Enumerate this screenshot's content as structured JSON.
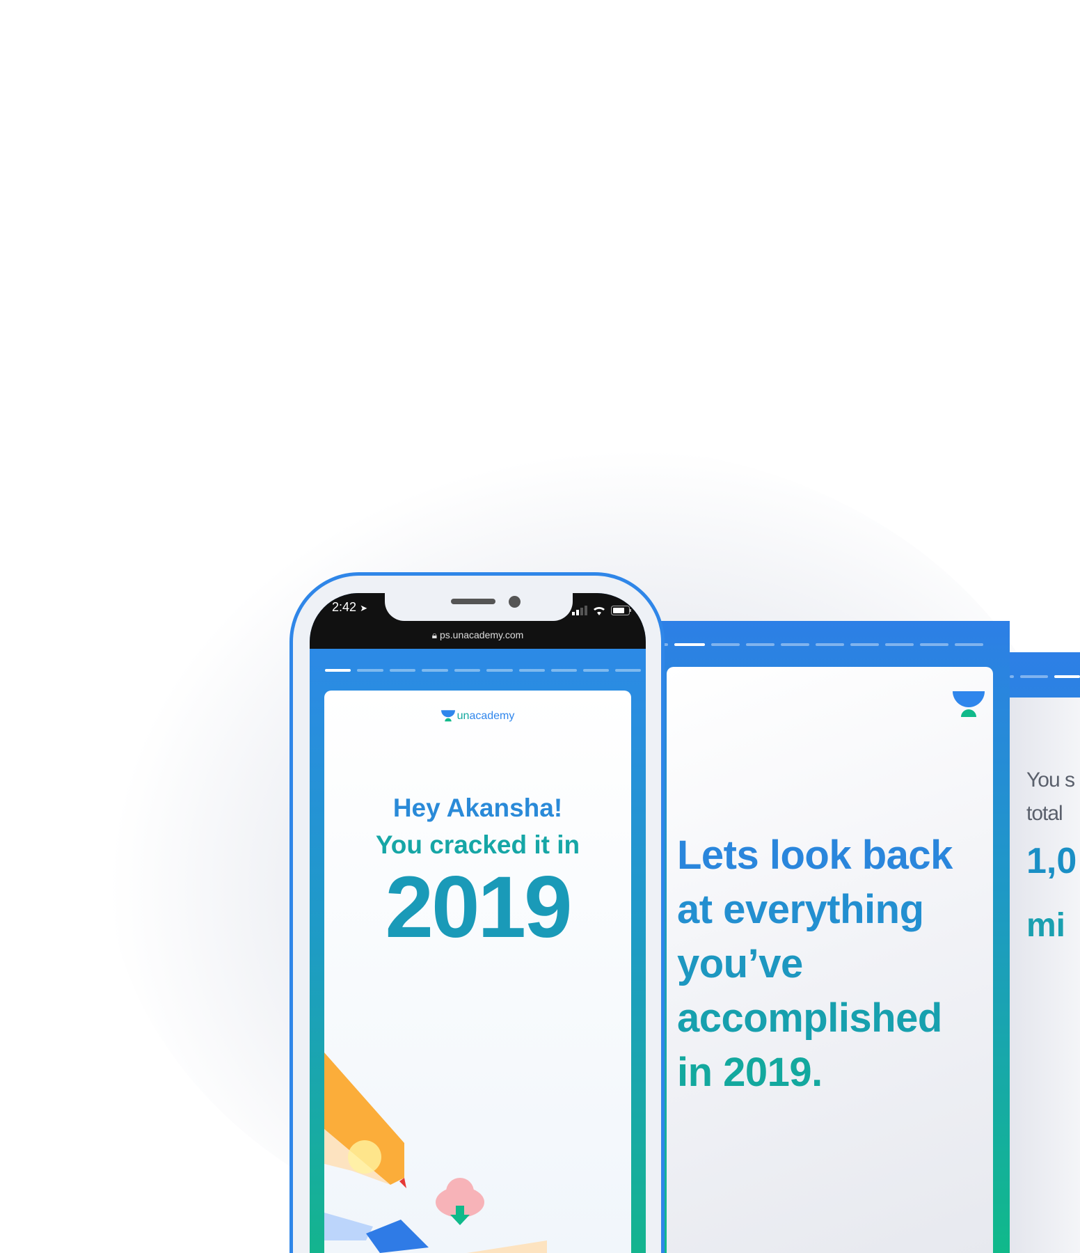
{
  "status_bar": {
    "time": "2:42",
    "url": "ps.unacademy.com"
  },
  "brand": {
    "logo_text_un": "un",
    "logo_text_rest": "academy"
  },
  "card1": {
    "greeting": "Hey Akansha!",
    "subtitle": "You cracked it in",
    "year": "2019"
  },
  "card2": {
    "lines": [
      "Lets look back",
      "at everything",
      "you’ve",
      "accomplished",
      "in 2019."
    ]
  },
  "card3": {
    "lines": [
      "You s",
      "total"
    ],
    "number": "1,0",
    "unit": "mi"
  },
  "colors": {
    "blue": "#2f86e8",
    "teal": "#13a89e",
    "green": "#10b98a",
    "gray": "#5a606c"
  },
  "progress": {
    "total_steps": 10,
    "card1_current": 1,
    "card2_current": 2
  }
}
